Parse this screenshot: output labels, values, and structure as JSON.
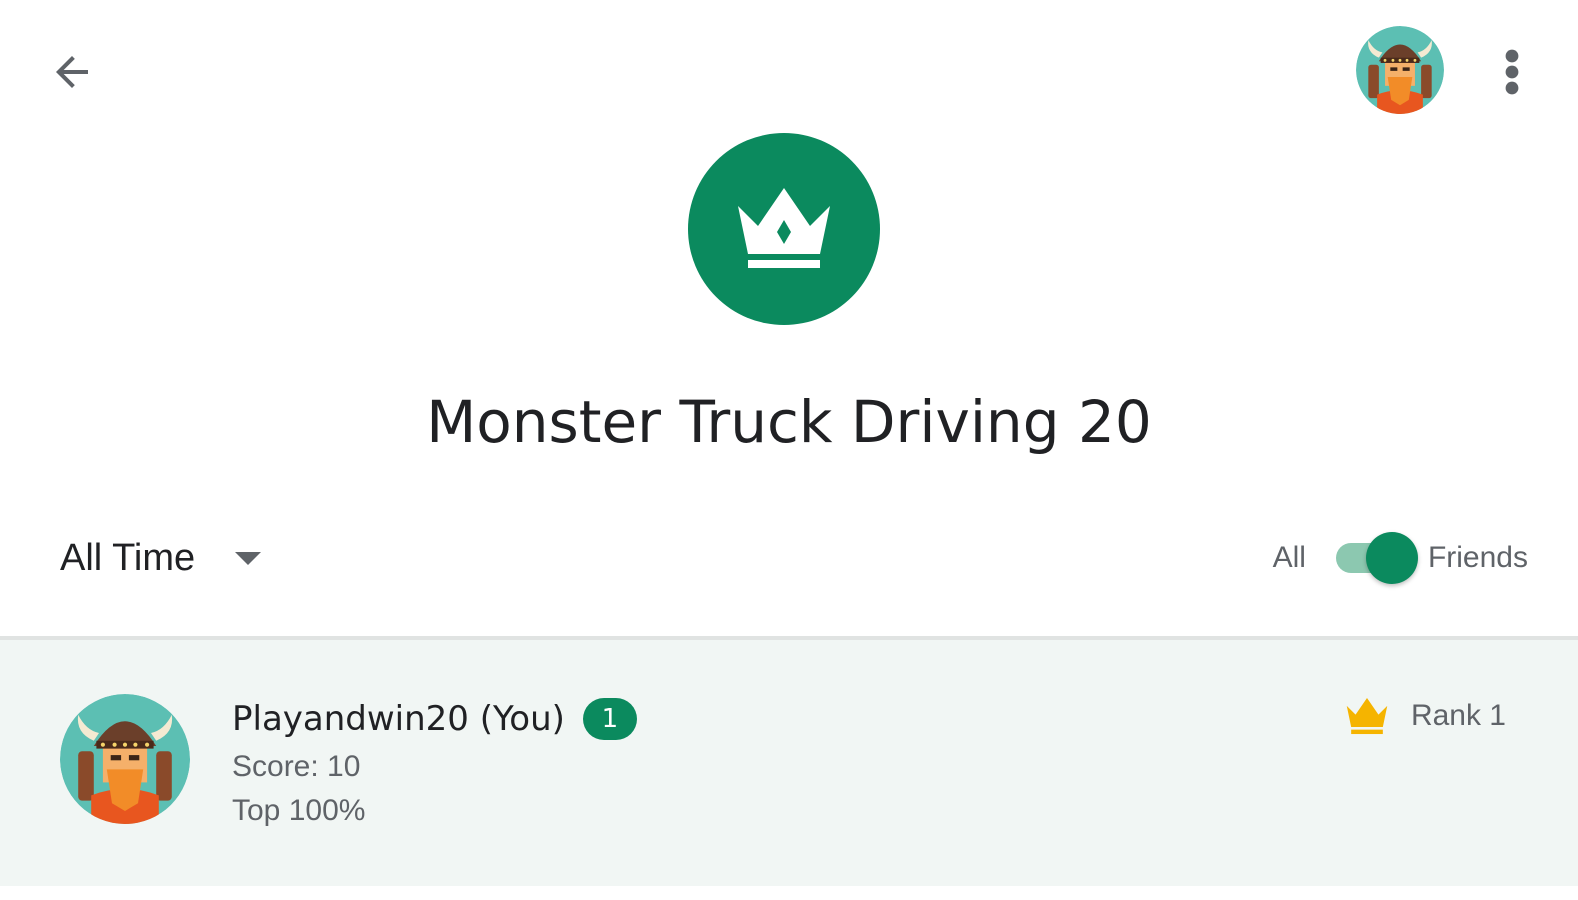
{
  "header": {
    "back_icon": "arrow-back-icon",
    "profile_icon": "viking-avatar-icon",
    "more_icon": "more-vert-icon"
  },
  "leaderboard": {
    "icon": "crown-icon",
    "icon_color": "#0b8a5e",
    "title": "Monster Truck Driving 20"
  },
  "filters": {
    "time_range": "All Time",
    "scope_left": "All",
    "scope_right": "Friends",
    "scope_selected": "Friends"
  },
  "player": {
    "name": "Playandwin20 (You)",
    "level": "1",
    "score": "Score: 10",
    "top": "Top 100%",
    "rank": "Rank 1",
    "rank_icon_color": "#f5b400"
  },
  "colors": {
    "accent": "#0b8a5e",
    "row_background": "#f1f6f4",
    "text_primary": "#202124",
    "text_secondary": "#5f6368"
  }
}
